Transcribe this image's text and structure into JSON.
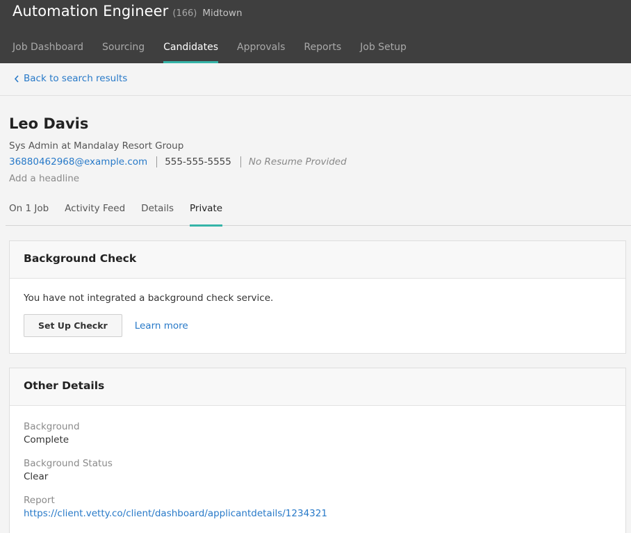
{
  "header": {
    "job_title": "Automation Engineer",
    "job_count": "(166)",
    "location": "Midtown",
    "nav": [
      {
        "label": "Job Dashboard",
        "active": false
      },
      {
        "label": "Sourcing",
        "active": false
      },
      {
        "label": "Candidates",
        "active": true
      },
      {
        "label": "Approvals",
        "active": false
      },
      {
        "label": "Reports",
        "active": false
      },
      {
        "label": "Job Setup",
        "active": false
      }
    ]
  },
  "back_link": "Back to search results",
  "candidate": {
    "name": "Leo Davis",
    "subtitle": "Sys Admin at Mandalay Resort Group",
    "email": "36880462968@example.com",
    "phone": "555-555-5555",
    "resume": "No Resume Provided",
    "headline_placeholder": "Add a headline"
  },
  "tabs": [
    {
      "label": "On 1 Job",
      "active": false
    },
    {
      "label": "Activity Feed",
      "active": false
    },
    {
      "label": "Details",
      "active": false
    },
    {
      "label": "Private",
      "active": true
    }
  ],
  "background_check": {
    "title": "Background Check",
    "message": "You have not integrated a background check service.",
    "setup_button": "Set Up Checkr",
    "learn_more": "Learn more"
  },
  "other_details": {
    "title": "Other Details",
    "fields": [
      {
        "label": "Background",
        "value": "Complete"
      },
      {
        "label": "Background Status",
        "value": "Clear"
      },
      {
        "label": "Report",
        "value": "https://client.vetty.co/client/dashboard/applicantdetails/1234321"
      }
    ]
  },
  "colors": {
    "accent": "#35b4a8",
    "link": "#2779c8",
    "topbar": "#3f3f3f"
  },
  "icons": {
    "back": "chevron-left-icon"
  }
}
